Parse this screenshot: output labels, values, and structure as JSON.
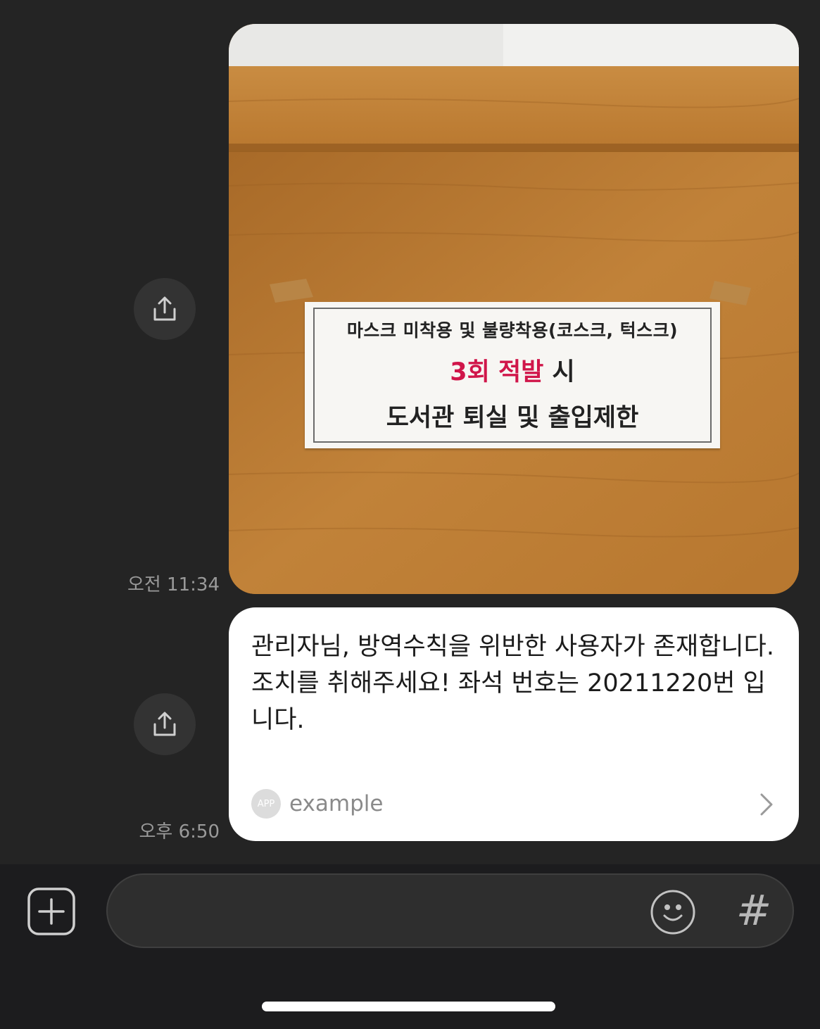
{
  "messages": [
    {
      "type": "image",
      "time": "오전 11:34",
      "notice": {
        "line1": "마스크 미착용 및 불량착용(코스크, 턱스크)",
        "line2_highlight": "3회 적발",
        "line2_rest": " 시",
        "line3": "도서관 퇴실 및 출입제한"
      }
    },
    {
      "type": "text",
      "time": "오후 6:50",
      "text": "관리자님, 방역수칙을 위반한 사용자가 존재합니다. 조치를 취해주세요! 좌석 번호는 20211220번 입니다.",
      "app_badge": "APP",
      "app_name": "example"
    }
  ],
  "composer": {
    "input_value": "",
    "hash_symbol": "#"
  },
  "icons": {
    "share": "share-icon",
    "plus": "plus-icon",
    "emoji": "emoji-icon",
    "chevron": "chevron-right-icon"
  },
  "colors": {
    "background": "#242424",
    "bubble": "#ffffff",
    "notice_highlight": "#d0164a",
    "timestamp": "#9a9a9a"
  }
}
